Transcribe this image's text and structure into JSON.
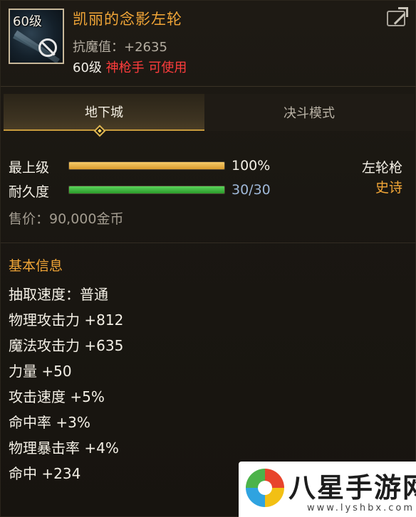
{
  "item": {
    "level_badge": "60级",
    "name": "凯丽的念影左轮",
    "magic_resist": "抗魔值：+2635",
    "required_level": "60级",
    "required_class": "神枪手 可使用"
  },
  "tabs": [
    {
      "label": "地下城",
      "active": true
    },
    {
      "label": "决斗模式",
      "active": false
    }
  ],
  "stats": {
    "upgrade_label": "最上级",
    "upgrade_value": "100%",
    "upgrade_progress": 1.0,
    "durability_label": "耐久度",
    "durability_value": "30/30",
    "durability_progress": 1.0,
    "weapon_type": "左轮枪",
    "rarity": "史诗",
    "price": "售价：90,000金币"
  },
  "basic_info": {
    "title": "基本信息",
    "attributes": [
      "抽取速度：普通",
      "物理攻击力 +812",
      "魔法攻击力 +635",
      "力量 +50",
      "攻击速度 +5%",
      "命中率 +3%",
      "物理暴击率 +4%",
      "命中 +234"
    ]
  },
  "watermark": {
    "text": "八星手游网",
    "url": "www.lyshbx.com"
  },
  "colors": {
    "item_name": "#f2a637",
    "class_restriction": "#ff3c3c",
    "rarity": "#f2a637",
    "durability_text": "#9fb8d8",
    "section_title": "#f2a637"
  },
  "icons": [
    "item-weapon-icon",
    "no-use-icon",
    "share-icon",
    "tab-diamond-icon"
  ]
}
